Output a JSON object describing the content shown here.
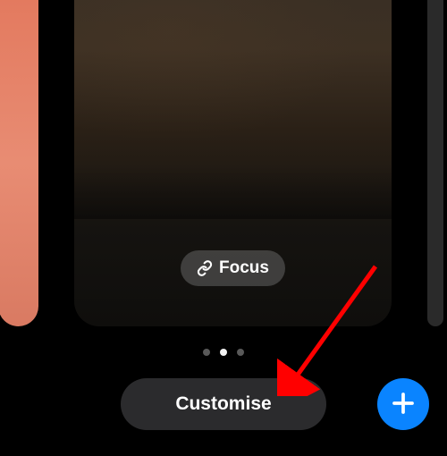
{
  "focus_button": {
    "label": "Focus",
    "icon": "link-icon"
  },
  "pagination": {
    "total_pages": 3,
    "active_index": 1
  },
  "customise_button": {
    "label": "Customise"
  },
  "add_button": {
    "icon": "plus-icon"
  },
  "colors": {
    "accent_blue": "#0a84ff",
    "pill_dark": "#2b2b2d",
    "left_card_gradient_start": "#e37a5f",
    "left_card_gradient_end": "#d97a62"
  },
  "annotation": {
    "type": "red-arrow",
    "points_to": "customise-button"
  }
}
